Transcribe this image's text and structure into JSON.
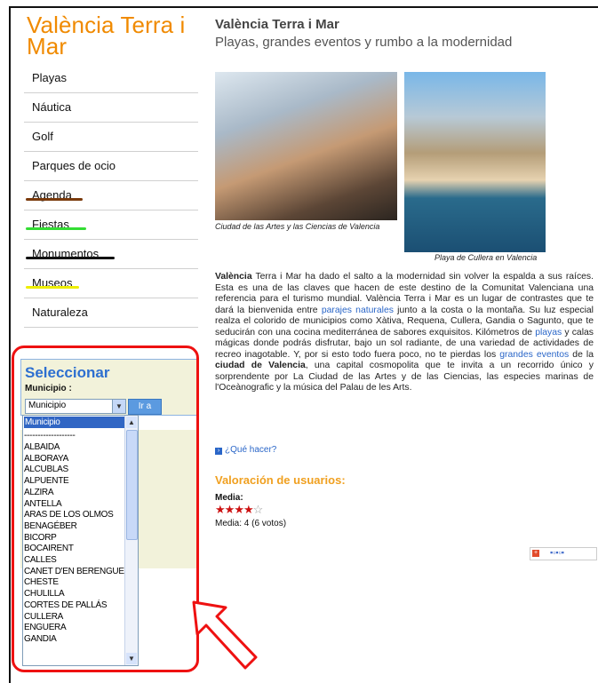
{
  "sidebar": {
    "title": "València Terra i Mar",
    "items": [
      {
        "label": "Playas"
      },
      {
        "label": "Náutica"
      },
      {
        "label": "Golf"
      },
      {
        "label": "Parques de ocio"
      },
      {
        "label": "Agenda",
        "underline": "brown"
      },
      {
        "label": "Fiestas",
        "underline": "green"
      },
      {
        "label": "Monumentos",
        "underline": "black"
      },
      {
        "label": "Museos",
        "underline": "yellow"
      },
      {
        "label": "Naturaleza"
      }
    ]
  },
  "selector": {
    "title": "Seleccionar",
    "label": "Municipio :",
    "value": "Municipio",
    "button": "Ir a",
    "options": [
      "Municipio",
      "-------------------",
      "ALBAIDA",
      "ALBORAYA",
      "ALCUBLAS",
      "ALPUENTE",
      "ALZIRA",
      "ANTELLA",
      "ARAS DE LOS OLMOS",
      "BENAGÉBER",
      "BICORP",
      "BOCAIRENT",
      "CALLES",
      "CANET D'EN BERENGUER",
      "CHESTE",
      "CHULILLA",
      "CORTES DE PALLÁS",
      "CULLERA",
      "ENGUERA",
      "GANDIA"
    ]
  },
  "main": {
    "title": "València Terra i Mar",
    "subtitle": "Playas, grandes eventos y rumbo a la modernidad",
    "caption1": "Ciudad de las Artes y las Ciencias de Valencia",
    "caption2": "Playa de Cullera en Valencia",
    "body": {
      "p1": "València",
      "p2": " Terra i Mar ha dado el salto a la modernidad sin volver la espalda a sus raíces. Esta es una de las claves que hacen de este destino de la Comunitat Valenciana una referencia para el turismo mundial. València Terra i Mar es un lugar de contrastes que te dará la bienvenida entre ",
      "l1": "parajes naturales",
      "p3": " junto a la costa o la montaña. Su luz especial realza el colorido de municipios como Xàtiva, Requena, Cullera, Gandia o Sagunto, que te seducirán con una cocina mediterránea de sabores exquisitos. Kilómetros de ",
      "l2": "playas",
      "p4": " y calas mágicas donde podrás disfrutar, bajo un sol radiante, de una variedad de actividades de recreo inagotable. Y, por si esto todo fuera poco, no te pierdas los ",
      "l3": "grandes eventos",
      "p5": " de la ",
      "b2": "ciudad de Valencia",
      "p6": ", una capital cosmopolita que te invita a un recorrido único y sorprendente por La Ciudad de las Artes y de las Ciencias, las especies marinas de l'Oceànografic y la música del Palau de les Arts."
    },
    "que_hacer": "¿Qué hacer?",
    "rating": {
      "title": "Valoración de usuarios:",
      "label": "Media:",
      "stars": 4,
      "max": 5,
      "summary": "Media: 4 (6 votos)"
    }
  },
  "colors": {
    "title_orange": "#f08a00",
    "link_blue": "#2a66c8",
    "highlight_red": "#ee1111"
  }
}
